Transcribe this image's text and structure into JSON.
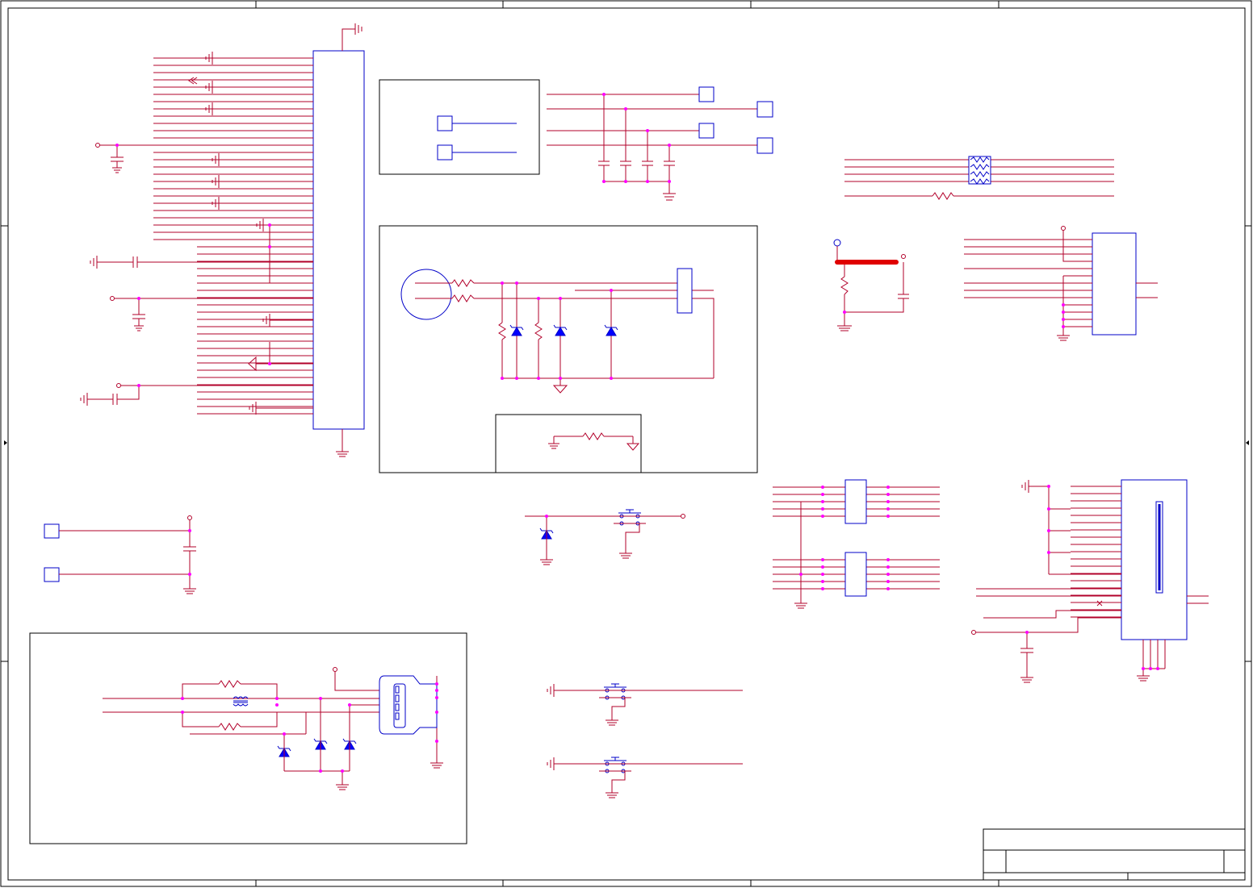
{
  "sheet": {
    "title_block": {
      "title": "",
      "sheet_label": "",
      "revision": ""
    }
  },
  "colors": {
    "wire": "#b2002a",
    "component": "#0000c8",
    "junction": "#ff00ff",
    "border": "#000000",
    "highlight_net": "#e00000",
    "diode_fill": "#0000ff",
    "background": "#ffffff"
  },
  "blocks": [
    {
      "id": "main-connector",
      "kind": "connector"
    },
    {
      "id": "sub-sheet-top",
      "kind": "frame"
    },
    {
      "id": "speaker-protection",
      "kind": "frame"
    },
    {
      "id": "usb-port",
      "kind": "frame"
    },
    {
      "id": "sd-card-slot",
      "kind": "connector"
    },
    {
      "id": "push-buttons",
      "kind": "switch",
      "count": 3
    },
    {
      "id": "tvs-diodes",
      "kind": "diode",
      "count": 8
    }
  ]
}
